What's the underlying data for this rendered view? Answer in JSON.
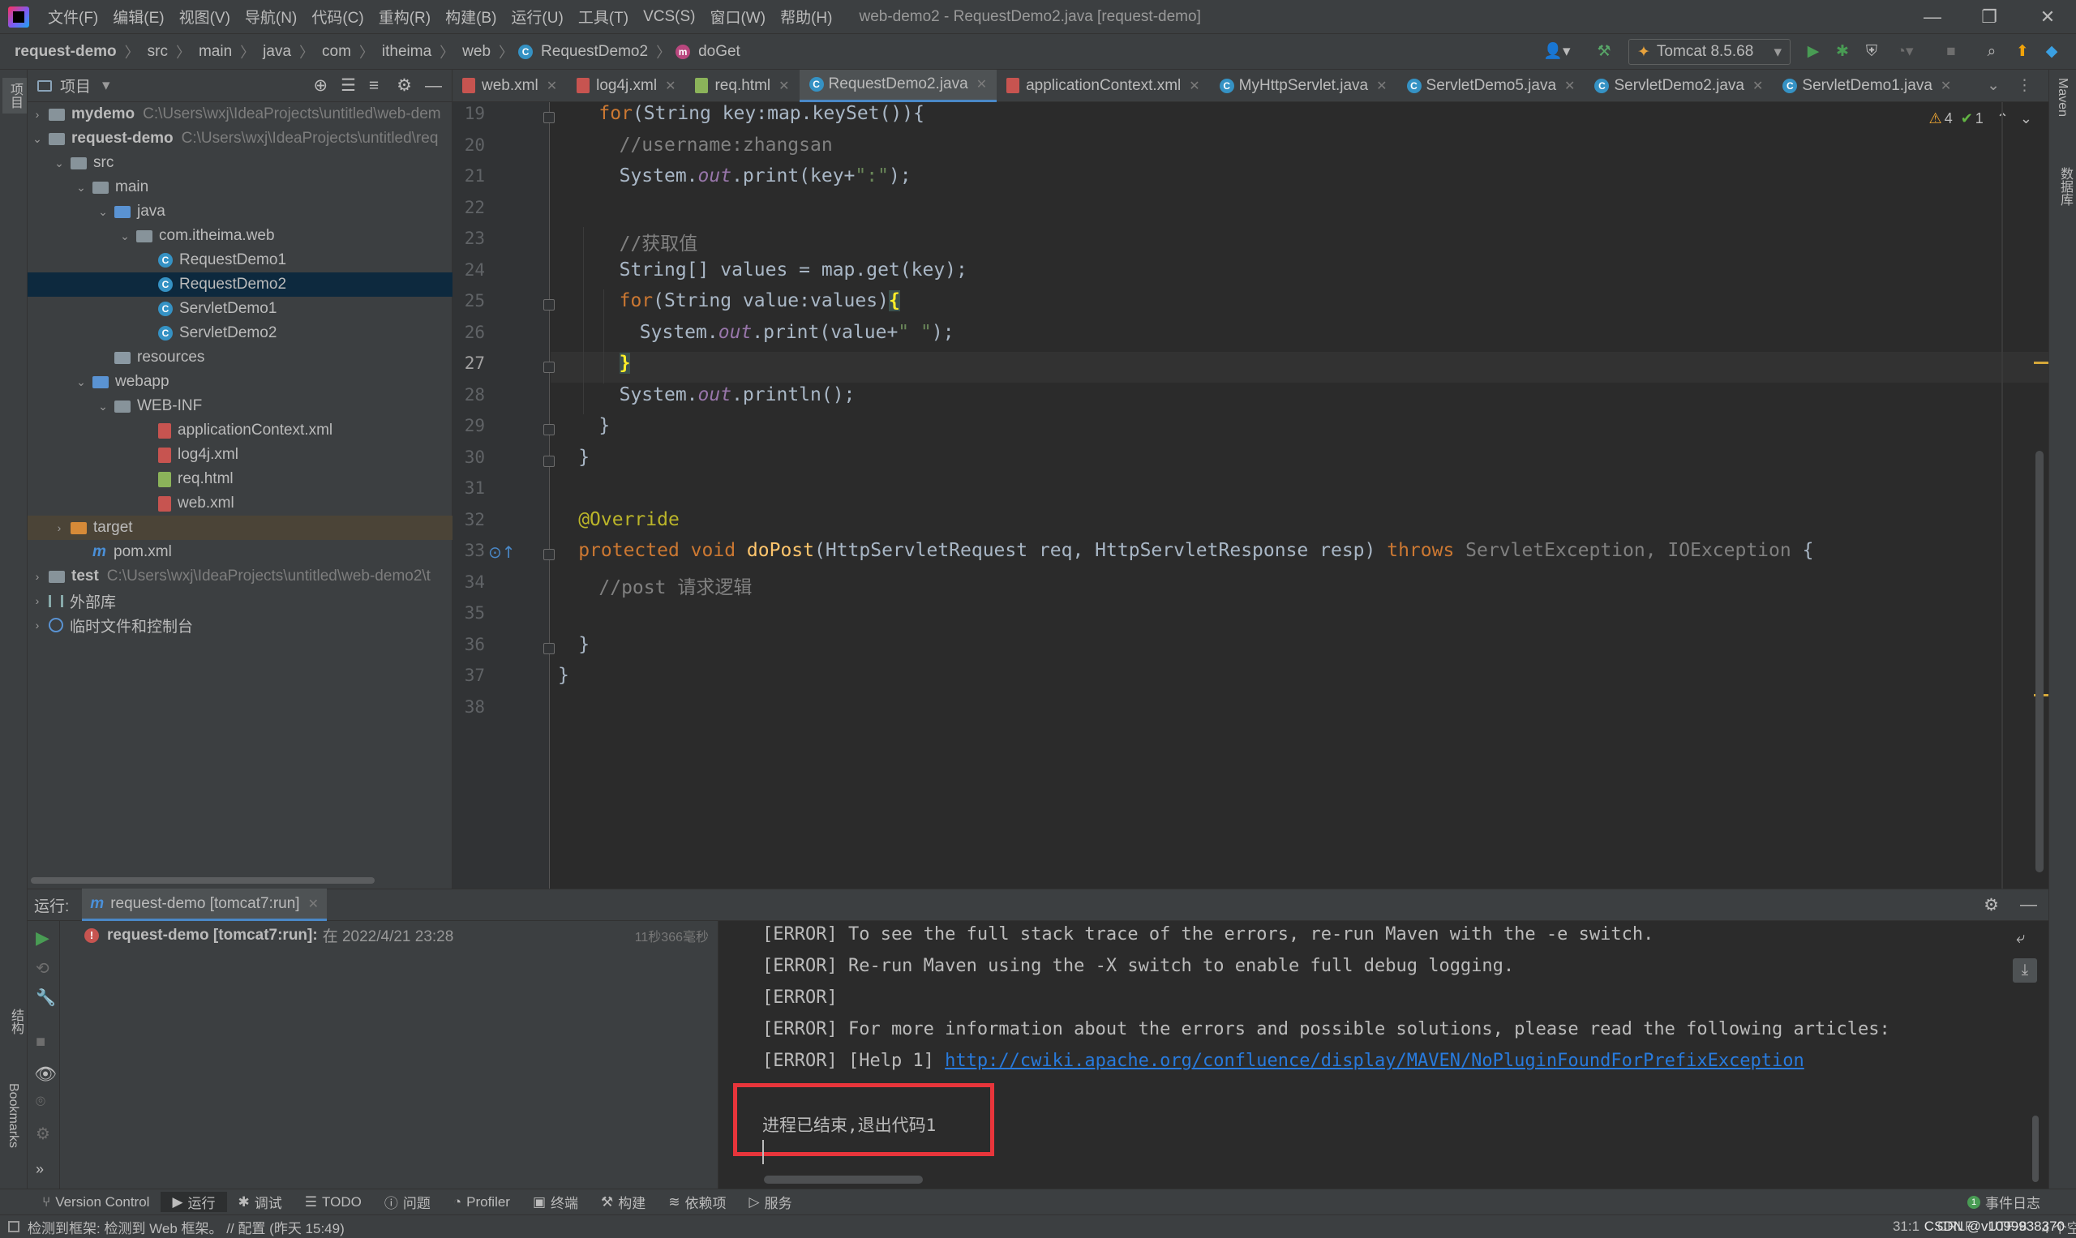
{
  "menubar": {
    "items": [
      "文件(F)",
      "编辑(E)",
      "视图(V)",
      "导航(N)",
      "代码(C)",
      "重构(R)",
      "构建(B)",
      "运行(U)",
      "工具(T)",
      "VCS(S)",
      "窗口(W)",
      "帮助(H)"
    ],
    "window_title": "web-demo2 - RequestDemo2.java [request-demo]"
  },
  "navbar": {
    "crumbs": [
      "request-demo",
      "src",
      "main",
      "java",
      "com",
      "itheima",
      "web",
      "RequestDemo2",
      "doGet"
    ],
    "run_config": "Tomcat 8.5.68"
  },
  "project": {
    "title": "项目",
    "tree": [
      {
        "label": "mydemo",
        "path": "C:\\Users\\wxj\\IdeaProjects\\untitled\\web-dem",
        "indent": 0,
        "arrow": "›",
        "icon": "folder",
        "bold": true
      },
      {
        "label": "request-demo",
        "path": "C:\\Users\\wxj\\IdeaProjects\\untitled\\req",
        "indent": 0,
        "arrow": "⌄",
        "icon": "folder",
        "bold": true
      },
      {
        "label": "src",
        "indent": 1,
        "arrow": "⌄",
        "icon": "folder"
      },
      {
        "label": "main",
        "indent": 2,
        "arrow": "⌄",
        "icon": "folder"
      },
      {
        "label": "java",
        "indent": 3,
        "arrow": "⌄",
        "icon": "folder-blue"
      },
      {
        "label": "com.itheima.web",
        "indent": 4,
        "arrow": "⌄",
        "icon": "folder"
      },
      {
        "label": "RequestDemo1",
        "indent": 5,
        "icon": "class"
      },
      {
        "label": "RequestDemo2",
        "indent": 5,
        "icon": "class",
        "selected": true
      },
      {
        "label": "ServletDemo1",
        "indent": 5,
        "icon": "class"
      },
      {
        "label": "ServletDemo2",
        "indent": 5,
        "icon": "class"
      },
      {
        "label": "resources",
        "indent": 3,
        "icon": "folder-res"
      },
      {
        "label": "webapp",
        "indent": 2,
        "arrow": "⌄",
        "icon": "folder-blue"
      },
      {
        "label": "WEB-INF",
        "indent": 3,
        "arrow": "⌄",
        "icon": "folder"
      },
      {
        "label": "applicationContext.xml",
        "indent": 5,
        "icon": "xml"
      },
      {
        "label": "log4j.xml",
        "indent": 5,
        "icon": "xml"
      },
      {
        "label": "req.html",
        "indent": 5,
        "icon": "html"
      },
      {
        "label": "web.xml",
        "indent": 5,
        "icon": "xml"
      },
      {
        "label": "target",
        "indent": 1,
        "arrow": "›",
        "icon": "folder-orange",
        "excluded": true
      },
      {
        "label": "pom.xml",
        "indent": 2,
        "icon": "maven"
      },
      {
        "label": "test",
        "path": "C:\\Users\\wxj\\IdeaProjects\\untitled\\web-demo2\\t",
        "indent": 0,
        "arrow": "›",
        "icon": "folder",
        "bold": true
      },
      {
        "label": "外部库",
        "indent": 0,
        "arrow": "›",
        "icon": "lib"
      },
      {
        "label": "临时文件和控制台",
        "indent": 0,
        "arrow": "›",
        "icon": "scratch"
      }
    ]
  },
  "tabs": [
    {
      "label": "web.xml",
      "icon": "xml"
    },
    {
      "label": "log4j.xml",
      "icon": "xml"
    },
    {
      "label": "req.html",
      "icon": "html"
    },
    {
      "label": "RequestDemo2.java",
      "icon": "class",
      "active": true
    },
    {
      "label": "applicationContext.xml",
      "icon": "xml"
    },
    {
      "label": "MyHttpServlet.java",
      "icon": "class"
    },
    {
      "label": "ServletDemo5.java",
      "icon": "class"
    },
    {
      "label": "ServletDemo2.java",
      "icon": "class"
    },
    {
      "label": "ServletDemo1.java",
      "icon": "class"
    }
  ],
  "editor": {
    "inspections": {
      "warnings": "4",
      "ok": "1"
    },
    "line_numbers": [
      "19",
      "20",
      "21",
      "22",
      "23",
      "24",
      "25",
      "26",
      "27",
      "28",
      "29",
      "30",
      "31",
      "32",
      "33",
      "34",
      "35",
      "36",
      "37",
      "38"
    ],
    "current_line": "27"
  },
  "code": {
    "l19": [
      "for",
      "(String key:map.keySet()){"
    ],
    "l20": [
      "//username:zhangsan"
    ],
    "l21": [
      "System.",
      "out",
      ".print(key+",
      "\":\"",
      ");"
    ],
    "l23": [
      "//获取值"
    ],
    "l24": [
      "String[] values = map.get(key);"
    ],
    "l25": [
      "for",
      "(String value:values)",
      "{"
    ],
    "l26": [
      "System.",
      "out",
      ".print(value+",
      "\" \"",
      ");"
    ],
    "l27": [
      "}"
    ],
    "l28": [
      "System.",
      "out",
      ".println();"
    ],
    "l29": [
      "}"
    ],
    "l30": [
      "}"
    ],
    "l32": [
      "@Override"
    ],
    "l33": [
      "protected void ",
      "doPost",
      "(HttpServletRequest req, HttpServletResponse resp) ",
      "throws ",
      "ServletException, IOException",
      " {"
    ],
    "l34": [
      "//post 请求逻辑"
    ],
    "l36": [
      "}"
    ],
    "l37": [
      "}"
    ]
  },
  "run": {
    "label": "运行:",
    "tab": "request-demo [tomcat7:run]",
    "tree_item": "request-demo [tomcat7:run]:",
    "tree_item_time": "在 2022/4/21 23:28",
    "duration": "11秒366毫秒",
    "console": [
      "[ERROR] To see the full stack trace of the errors, re-run Maven with the -e switch.",
      "[ERROR] Re-run Maven using the -X switch to enable full debug logging.",
      "[ERROR]",
      "[ERROR] For more information about the errors and possible solutions, please read the following articles:",
      "[ERROR] [Help 1] "
    ],
    "help_link": "http://cwiki.apache.org/confluence/display/MAVEN/NoPluginFoundForPrefixException",
    "exit_message": "进程已结束,退出代码1"
  },
  "toolwindows": [
    "Version Control",
    "运行",
    "调试",
    "TODO",
    "问题",
    "Profiler",
    "终端",
    "构建",
    "依赖项",
    "服务"
  ],
  "event_log": "事件日志",
  "status": {
    "message": "检测到框架: 检测到 Web 框架。 // 配置 (昨天 15:49)",
    "position": "31:1",
    "line_sep": "CRLF",
    "encoding": "UTF-8",
    "indent": "4 个空格",
    "watermark": "CSDN @v1099938370"
  },
  "side": {
    "project": "项目",
    "structure": "结构",
    "bookmarks": "Bookmarks",
    "maven": "Maven",
    "database": "数据库"
  },
  "colors": {
    "highlight_box": "#e8353b",
    "accent": "#4a88c7"
  }
}
